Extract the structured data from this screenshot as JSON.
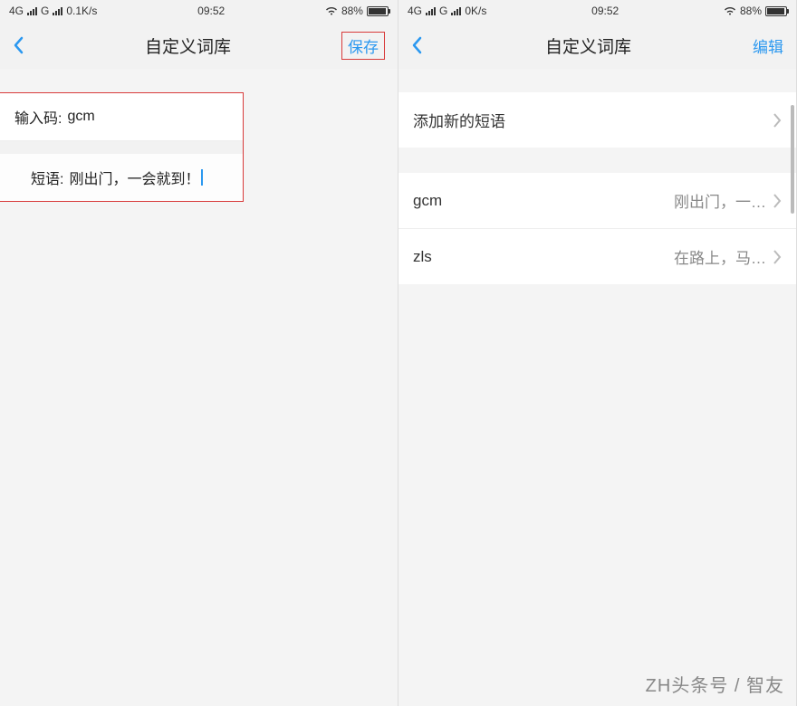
{
  "status": {
    "net_label": "4G",
    "sim_label": "G",
    "speed_left": "0.1K/s",
    "speed_right": "0K/s",
    "time": "09:52",
    "battery_pct": "88%"
  },
  "left": {
    "title": "自定义词库",
    "action": "保存",
    "input_code_label": "输入码:",
    "input_code_value": "gcm",
    "phrase_label": "短语:",
    "phrase_value": "刚出门，一会就到！"
  },
  "right": {
    "title": "自定义词库",
    "action": "编辑",
    "add_label": "添加新的短语",
    "items": [
      {
        "code": "gcm",
        "phrase": "刚出门，一…"
      },
      {
        "code": "zls",
        "phrase": "在路上，马…"
      }
    ]
  },
  "watermark": "ZH头条号 / 智友"
}
